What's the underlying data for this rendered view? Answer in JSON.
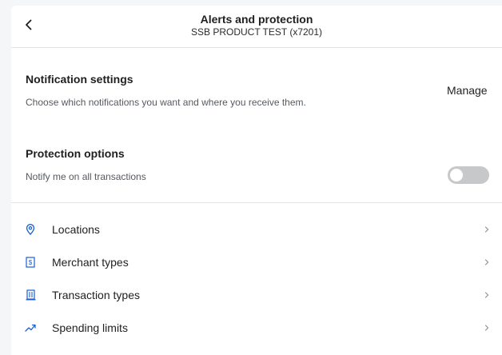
{
  "header": {
    "title": "Alerts and protection",
    "subtitle": "SSB PRODUCT TEST (x7201)",
    "back_icon": "chevron-left-icon"
  },
  "notification_settings": {
    "title": "Notification settings",
    "description": "Choose which notifications you want and where you receive them.",
    "manage_label": "Manage"
  },
  "protection_options": {
    "title": "Protection options",
    "toggle_label": "Notify me on all transactions",
    "toggle_on": false
  },
  "rows": [
    {
      "label": "Locations",
      "icon": "location-pin-icon"
    },
    {
      "label": "Merchant types",
      "icon": "dollar-receipt-icon"
    },
    {
      "label": "Transaction types",
      "icon": "building-icon"
    },
    {
      "label": "Spending limits",
      "icon": "trending-up-icon"
    }
  ],
  "colors": {
    "accent_icon": "#1a5fd0",
    "toggle_off": "#c7c8ca"
  }
}
